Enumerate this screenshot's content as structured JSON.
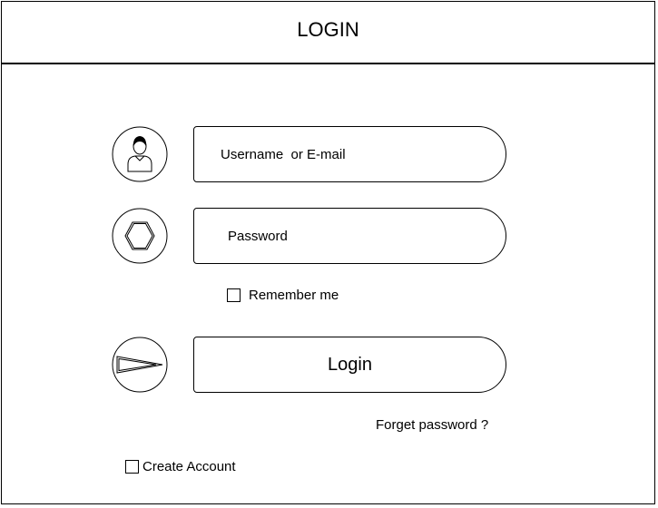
{
  "header": {
    "title": "LOGIN"
  },
  "form": {
    "username": {
      "placeholder": "Username  or E-mail",
      "value": "",
      "icon": "user-icon"
    },
    "password": {
      "placeholder": "Password",
      "value": "",
      "icon": "hexagon-lock-icon"
    },
    "remember_me": {
      "label": "Remember me",
      "checked": false
    },
    "login_button": {
      "label": "Login",
      "icon": "arrow-right-icon"
    },
    "forgot_password": {
      "label": "Forget password ?"
    },
    "create_account": {
      "label": "Create Account",
      "checked": false
    }
  }
}
